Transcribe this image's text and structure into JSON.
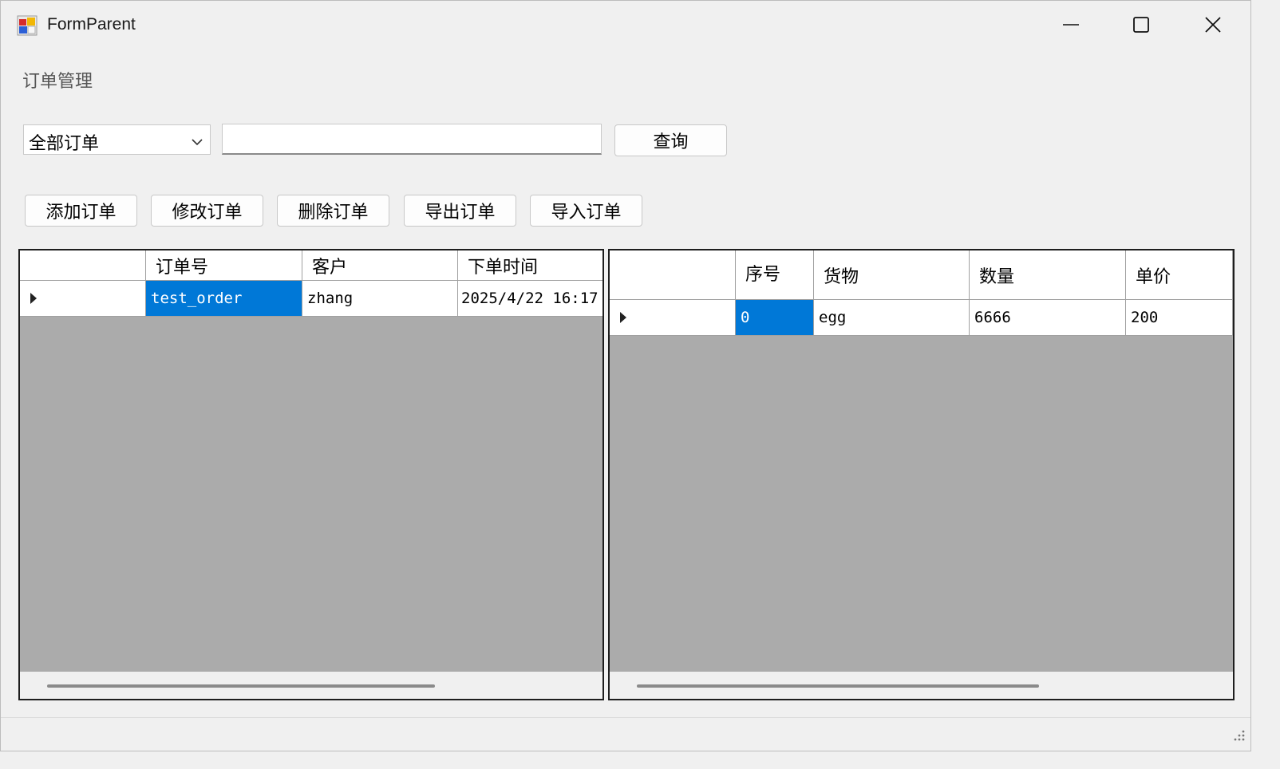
{
  "window": {
    "title": "FormParent",
    "icon": "winforms-app-icon"
  },
  "section_label": "订单管理",
  "filter": {
    "selected": "全部订单",
    "search_value": "",
    "query_label": "查询"
  },
  "actions": [
    {
      "label": "添加订单"
    },
    {
      "label": "修改订单"
    },
    {
      "label": "删除订单"
    },
    {
      "label": "导出订单"
    },
    {
      "label": "导入订单"
    }
  ],
  "orders_grid": {
    "columns": [
      "订单号",
      "客户",
      "下单时间"
    ],
    "rows": [
      {
        "cells": [
          "test_order",
          "zhang",
          "2025/4/22 16:17"
        ]
      }
    ]
  },
  "items_grid": {
    "columns": [
      "序号",
      "货物",
      "数量",
      "单价"
    ],
    "rows": [
      {
        "cells": [
          "0",
          "egg",
          "6666",
          "200"
        ]
      }
    ]
  },
  "colors": {
    "selection": "#0078d7",
    "grid_background": "#ababab",
    "window_background": "#f0f0f0"
  }
}
